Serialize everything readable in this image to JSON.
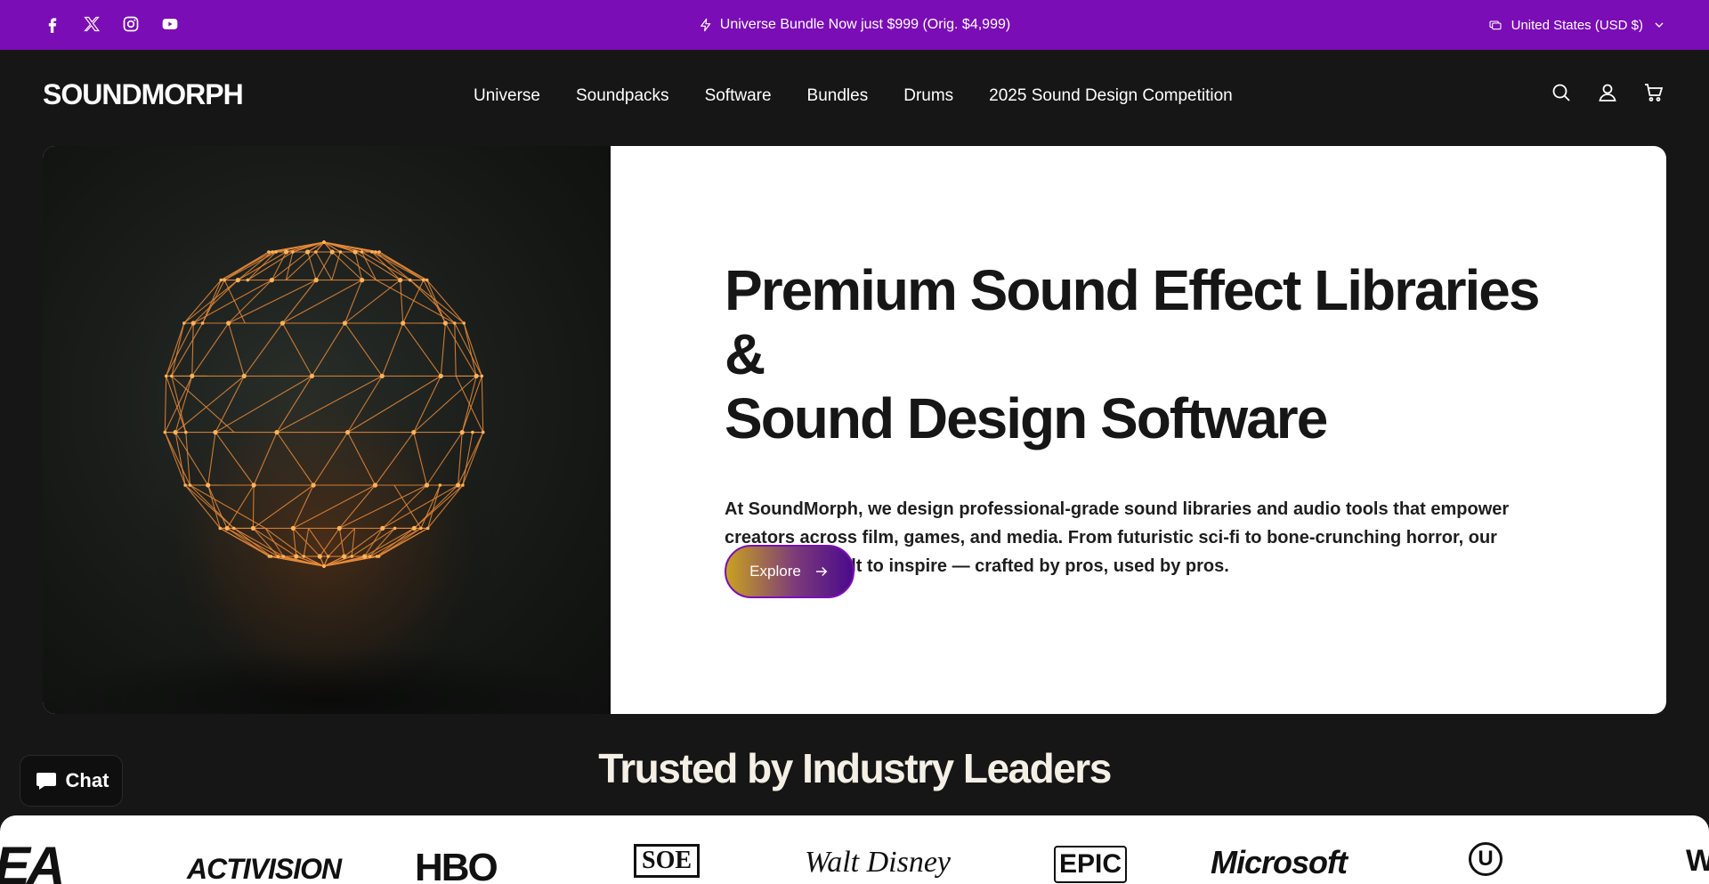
{
  "announcement": {
    "text": "Universe Bundle Now just $999 (Orig. $4,999)",
    "locale": "United States (USD $)",
    "socials": [
      "facebook-icon",
      "x-icon",
      "instagram-icon",
      "youtube-icon"
    ]
  },
  "header": {
    "logo_text": "SOUNDMORPH",
    "nav": [
      "Universe",
      "Soundpacks",
      "Software",
      "Bundles",
      "Drums",
      "2025 Sound Design Competition"
    ],
    "icons": [
      "search-icon",
      "account-icon",
      "cart-icon"
    ]
  },
  "hero": {
    "title_line1": "Premium Sound Effect Libraries &",
    "title_line2": "Sound Design Software",
    "body": "At SoundMorph, we design professional-grade sound libraries and audio tools that empower creators across film, games, and media. From futuristic sci-fi to bone-crunching horror, our sounds are built to inspire — crafted by pros, used by pros.",
    "cta": "Explore"
  },
  "trusted": {
    "title": "Trusted by Industry Leaders",
    "brands": [
      "EA",
      "ACTIVISION",
      "HBO",
      "SOE",
      "Walt Disney",
      "EPIC",
      "Microsoft",
      "U",
      "WB"
    ]
  },
  "chat": {
    "label": "Chat"
  },
  "colors": {
    "accent": "#7a0db5",
    "background": "#161616",
    "hero_panel": "#ffffff"
  }
}
